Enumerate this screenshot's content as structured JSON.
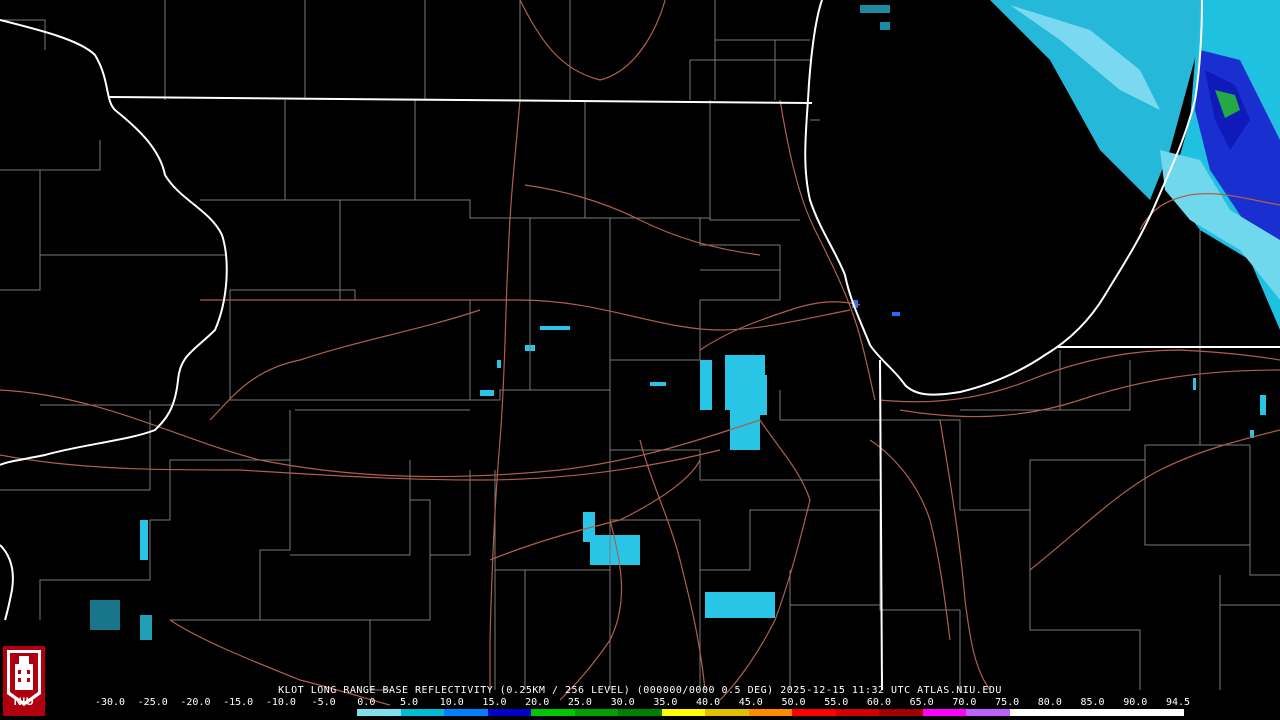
{
  "product": {
    "title": "KLOT LONG RANGE BASE REFLECTIVITY (0.25KM / 256 LEVEL) (000000/0000 0.5 DEG) 2025-12-15 11:32 UTC  ATLAS.NIU.EDU"
  },
  "colorbar": {
    "ticks": [
      "-30.0",
      "-25.0",
      "-20.0",
      "-15.0",
      "-10.0",
      "-5.0",
      "0.0",
      "5.0",
      "10.0",
      "15.0",
      "20.0",
      "25.0",
      "30.0",
      "35.0",
      "40.0",
      "45.0",
      "50.0",
      "55.0",
      "60.0",
      "65.0",
      "70.0",
      "75.0",
      "80.0",
      "85.0",
      "90.0",
      "94.5"
    ],
    "colors": [
      "#000000",
      "#000000",
      "#000000",
      "#000000",
      "#000000",
      "#000000",
      "#7fe1ee",
      "#00bcd4",
      "#0080ff",
      "#0000cc",
      "#00c800",
      "#00a000",
      "#008000",
      "#ffff00",
      "#e0c000",
      "#ff8c00",
      "#ff0000",
      "#d00000",
      "#a00000",
      "#ff00ff",
      "#c060ff",
      "#ffffff",
      "#ffffff",
      "#ffffff",
      "#ffffff"
    ]
  },
  "logo": {
    "text": "NIU"
  },
  "colors": {
    "state_lines": "#ffffff",
    "county_lines": "#7a7a7a",
    "highways": "#b0604a",
    "radar_light": "#29c5e6",
    "radar_dark": "#1022cc",
    "radar_green": "#22aa44"
  }
}
